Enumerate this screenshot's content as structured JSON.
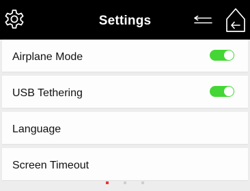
{
  "header": {
    "title": "Settings",
    "left_icon": "gear-icon",
    "right_icons": [
      "back-arrow-icon",
      "home-icon"
    ]
  },
  "colors": {
    "header_bg": "#000000",
    "toggle_on": "#44d634",
    "page_dot_active": "#e8313d",
    "page_dot_inactive": "#cfcfcf"
  },
  "settings": {
    "items": [
      {
        "label": "Airplane Mode",
        "toggle": true
      },
      {
        "label": "USB Tethering",
        "toggle": true
      },
      {
        "label": "Language"
      },
      {
        "label": "Screen Timeout"
      }
    ]
  },
  "pager": {
    "page_count": 3,
    "current_page": 1
  }
}
